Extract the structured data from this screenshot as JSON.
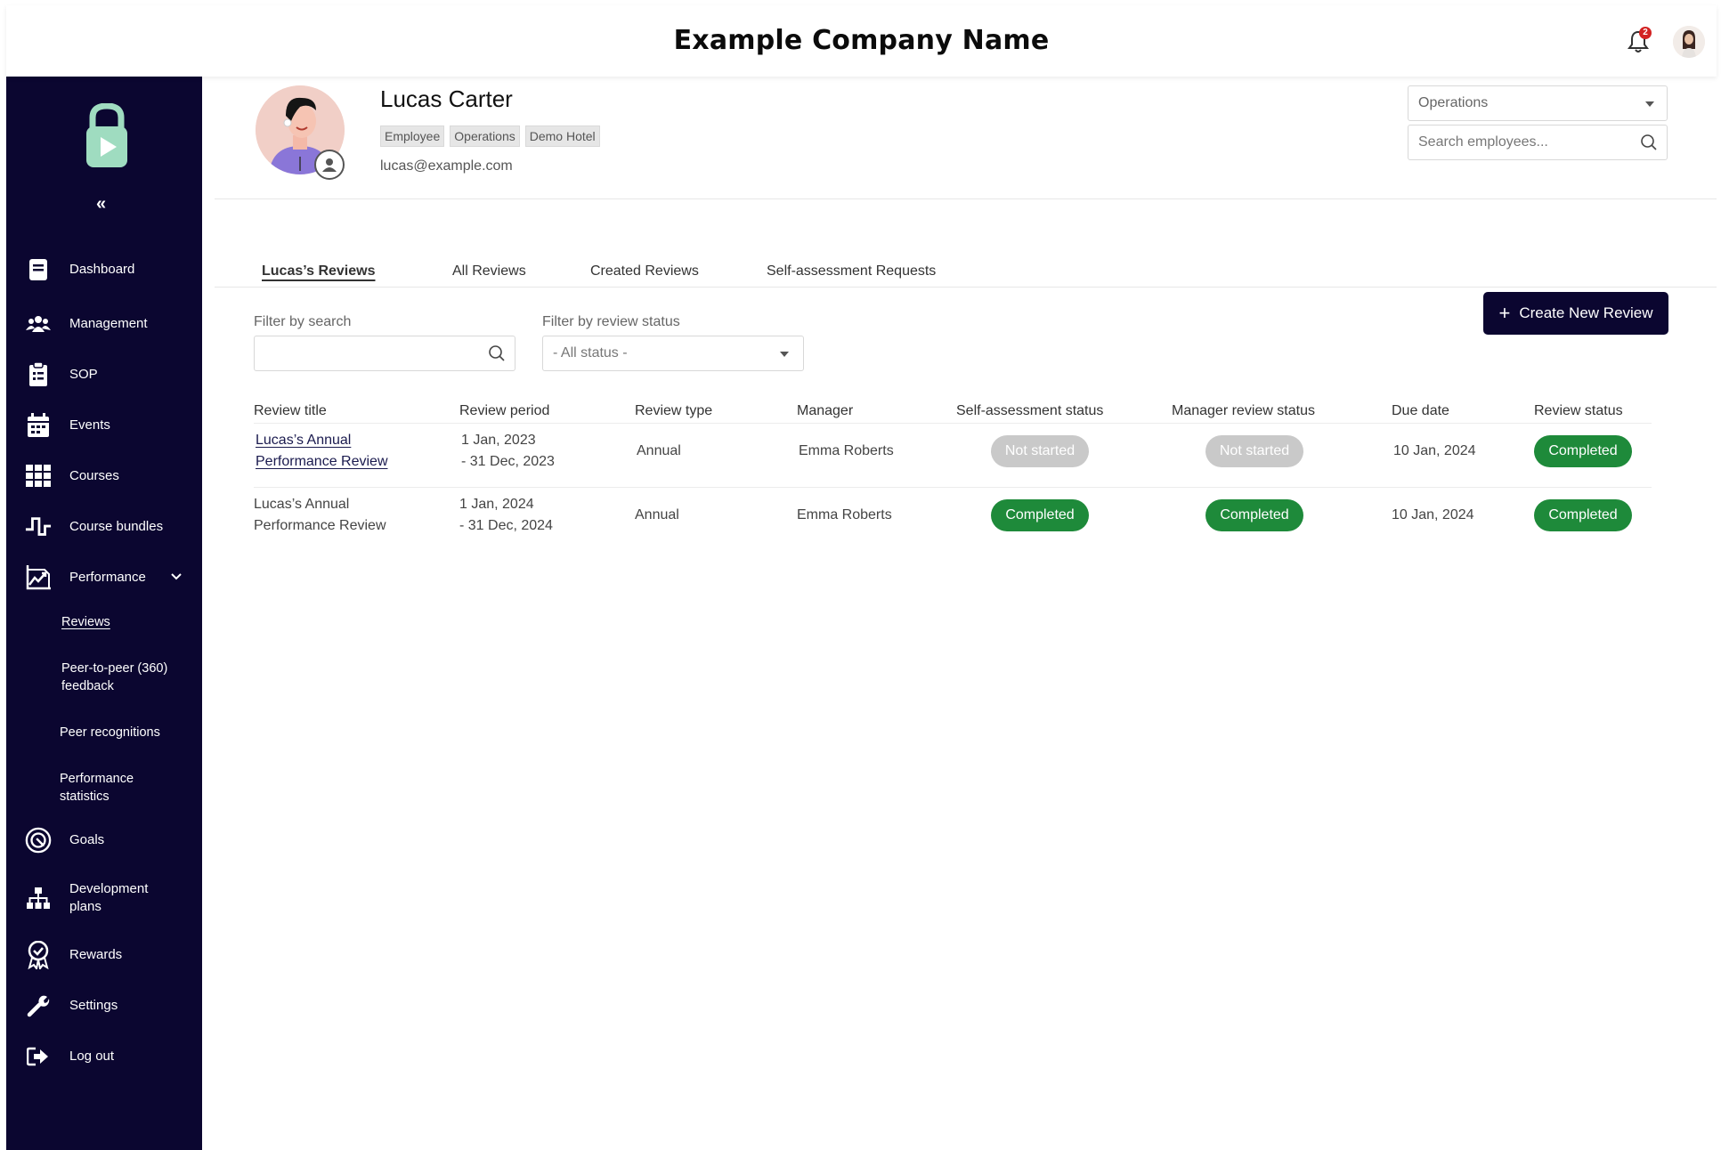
{
  "header": {
    "company": "Example Company Name",
    "notifications_count": "2"
  },
  "sidebar": {
    "items": [
      {
        "label": "Dashboard",
        "icon": "dashboard-icon"
      },
      {
        "label": "Management",
        "icon": "people-icon"
      },
      {
        "label": "SOP",
        "icon": "clipboard-icon"
      },
      {
        "label": "Events",
        "icon": "calendar-icon"
      },
      {
        "label": "Courses",
        "icon": "grid-icon"
      },
      {
        "label": "Course bundles",
        "icon": "bundle-icon"
      },
      {
        "label": "Performance",
        "icon": "chart-icon"
      },
      {
        "label": "Goals",
        "icon": "target-icon"
      },
      {
        "label": "Development plans",
        "icon": "hierarchy-icon"
      },
      {
        "label": "Rewards",
        "icon": "award-icon"
      },
      {
        "label": "Settings",
        "icon": "wrench-icon"
      },
      {
        "label": "Log out",
        "icon": "logout-icon"
      }
    ],
    "performance_sub": [
      {
        "label": "Reviews"
      },
      {
        "label": "Peer-to-peer (360) feedback"
      },
      {
        "label": "Peer recognitions"
      },
      {
        "label": "Performance statistics"
      }
    ]
  },
  "profile": {
    "name": "Lucas Carter",
    "tags": [
      "Employee",
      "Operations",
      "Demo Hotel"
    ],
    "email": "lucas@example.com"
  },
  "controls": {
    "department_selected": "Operations",
    "search_employees_placeholder": "Search employees..."
  },
  "tabs": [
    "Lucas’s Reviews",
    "All Reviews",
    "Created Reviews",
    "Self-assessment Requests"
  ],
  "filters": {
    "search_label": "Filter by search",
    "status_label": "Filter by review status",
    "status_selected": "- All status -"
  },
  "create_button": "Create New Review",
  "table": {
    "headers": [
      "Review title",
      "Review period",
      "Review type",
      "Manager",
      "Self-assessment status",
      "Manager review status",
      "Due date",
      "Review status"
    ],
    "rows": [
      {
        "title_line1": "Lucas’s Annual",
        "title_line2": "Performance Review",
        "period_line1": "1 Jan, 2023",
        "period_line2": "- 31 Dec, 2023",
        "type": "Annual",
        "manager": "Emma Roberts",
        "self_status": "Not started",
        "manager_status": "Not started",
        "due": "10 Jan, 2024",
        "review_status": "Completed"
      },
      {
        "title_line1": "Lucas’s Annual",
        "title_line2": "Performance Review",
        "period_line1": "1 Jan, 2024",
        "period_line2": "- 31 Dec, 2024",
        "type": "Annual",
        "manager": "Emma Roberts",
        "self_status": "Completed",
        "manager_status": "Completed",
        "due": "10 Jan, 2024",
        "review_status": "Completed"
      }
    ]
  },
  "colors": {
    "sidebar_bg": "#0b0630",
    "status_completed": "#1e8a3a",
    "status_not_started": "#c9c9c9"
  }
}
